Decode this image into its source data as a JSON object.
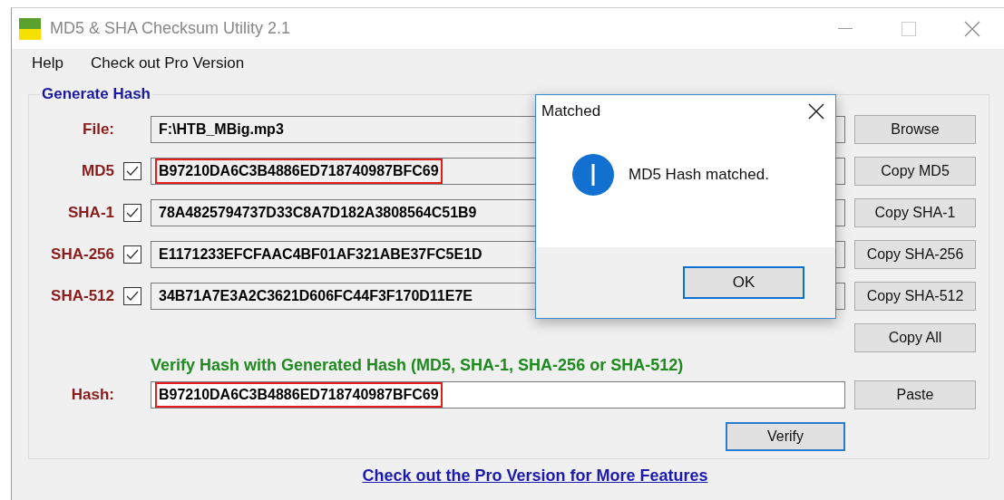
{
  "window": {
    "title": "MD5 & SHA Checksum Utility 2.1"
  },
  "menu": [
    {
      "label": "Help"
    },
    {
      "label": "Check out Pro Version"
    }
  ],
  "generate": {
    "title": "Generate Hash",
    "file": {
      "label": "File:",
      "value": "F:\\HTB_MBig.mp3"
    },
    "hashes": [
      {
        "label": "MD5",
        "checked": true,
        "value": "B97210DA6C3B4886ED718740987BFC69",
        "highlighted": true
      },
      {
        "label": "SHA-1",
        "checked": true,
        "value": "78A4825794737D33C8A7D182A3808564C51B9",
        "highlighted": false
      },
      {
        "label": "SHA-256",
        "checked": true,
        "value": "E1171233EFCFAAC4BF01AF321ABE37FC5E1D",
        "highlighted": false
      },
      {
        "label": "SHA-512",
        "checked": true,
        "value": "34B71A7E3A2C3621D606FC44F3F170D11E7E",
        "highlighted": false
      }
    ],
    "buttons": [
      "Browse",
      "Copy MD5",
      "Copy SHA-1",
      "Copy SHA-256",
      "Copy SHA-512",
      "Copy All"
    ]
  },
  "verify": {
    "title": "Verify Hash with Generated Hash (MD5, SHA-1, SHA-256 or SHA-512)",
    "label": "Hash:",
    "value": "B97210DA6C3B4886ED718740987BFC69",
    "highlighted": true,
    "paste_button": "Paste",
    "verify_button": "Verify"
  },
  "footer_link": "Check out the Pro Version for More Features",
  "dialog": {
    "title": "Matched",
    "message": "MD5 Hash matched.",
    "ok_button": "OK"
  }
}
